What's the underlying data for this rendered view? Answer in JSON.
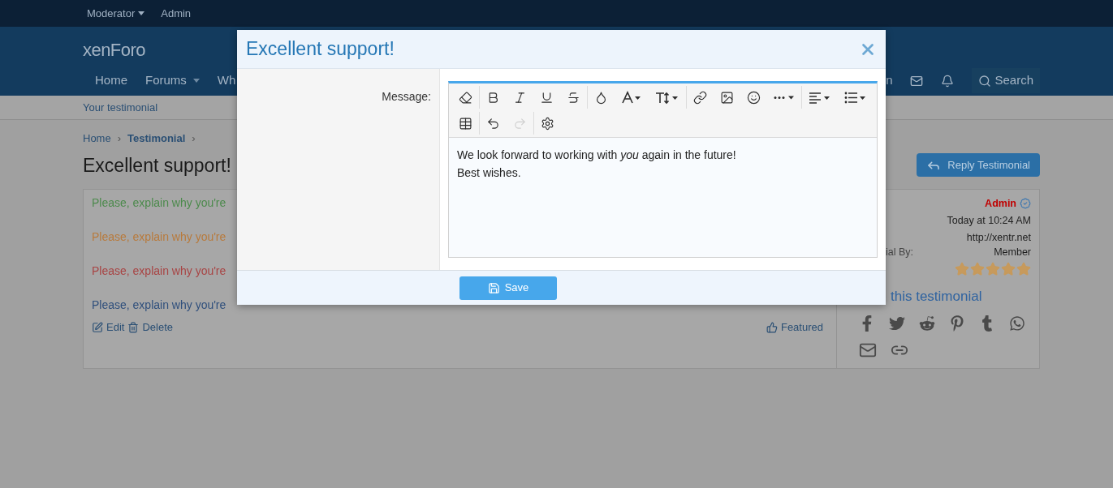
{
  "top_bar": {
    "items": [
      {
        "label": "Moderator",
        "dropdown": true
      },
      {
        "label": "Admin",
        "dropdown": false
      }
    ]
  },
  "header": {
    "logo": "xenForo"
  },
  "nav": {
    "items": [
      {
        "label": "Home",
        "dropdown": false
      },
      {
        "label": "Forums",
        "dropdown": true
      },
      {
        "label": "Wh",
        "dropdown": false
      }
    ],
    "cut_item": "n",
    "search": "Search"
  },
  "sub_nav": {
    "items": [
      "Your testimonial"
    ]
  },
  "breadcrumb": [
    {
      "label": "Home",
      "current": false,
      "separator": "›"
    },
    {
      "label": "Testimonial",
      "current": true,
      "separator": "›"
    }
  ],
  "page_title": "Excellent support!",
  "reply_button": "Reply Testimonial",
  "testimonial": {
    "lines": [
      {
        "text": "Please, explain why you're",
        "color": "#4c8a4c"
      },
      {
        "text": "Please, explain why you're",
        "color": "#b87a3c"
      },
      {
        "text": "Please, explain why you're",
        "color": "#a84444"
      },
      {
        "text": "Please, explain why you're",
        "color": "#2f4f7c"
      }
    ],
    "actions": [
      "Edit",
      "Delete"
    ],
    "featured": "Featured"
  },
  "sidebar": {
    "author": "Admin",
    "date": "Today at 10:24 AM",
    "website": "http://xentr.net",
    "by_label": "ial By:",
    "by_value": "Member",
    "stars": 5,
    "share_title": "this testimonial"
  },
  "modal": {
    "title": "Excellent support!",
    "field_label": "Message:",
    "toolbar_rows": [
      {
        "groups": [
          {
            "buttons": [
              {
                "kind": "eraser",
                "disabled": false
              }
            ]
          },
          {
            "buttons": [
              {
                "kind": "bold",
                "disabled": false
              },
              {
                "kind": "italic",
                "disabled": false
              },
              {
                "kind": "underline",
                "disabled": false
              },
              {
                "kind": "strike",
                "disabled": false
              }
            ]
          },
          {
            "buttons": [
              {
                "kind": "color",
                "disabled": false
              },
              {
                "kind": "font",
                "disabled": false
              },
              {
                "kind": "size",
                "disabled": false
              }
            ]
          },
          {
            "buttons": [
              {
                "kind": "link",
                "disabled": false
              },
              {
                "kind": "image",
                "disabled": false
              },
              {
                "kind": "smile",
                "disabled": false
              },
              {
                "kind": "more",
                "disabled": false
              }
            ]
          },
          {
            "buttons": [
              {
                "kind": "align",
                "disabled": false
              },
              {
                "kind": "list",
                "disabled": false
              }
            ]
          }
        ]
      },
      {
        "groups": [
          {
            "buttons": [
              {
                "kind": "table",
                "disabled": false
              }
            ]
          },
          {
            "buttons": [
              {
                "kind": "undo",
                "disabled": false
              },
              {
                "kind": "redo",
                "disabled": true
              }
            ]
          },
          {
            "buttons": [
              {
                "kind": "settings",
                "disabled": false
              }
            ]
          }
        ]
      }
    ],
    "message_lines": [
      "We look forward to working with *you* again in the future!",
      "Best wishes."
    ],
    "save_button": "Save"
  }
}
